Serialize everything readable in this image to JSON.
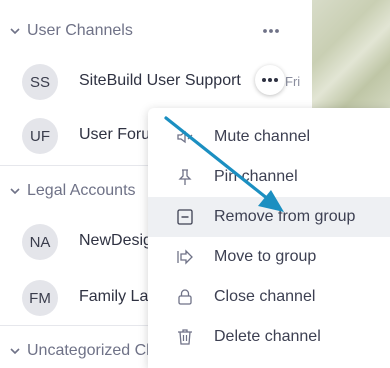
{
  "groups": [
    {
      "title": "User Channels"
    },
    {
      "title": "Legal Accounts"
    },
    {
      "title": "Uncategorized Channels"
    }
  ],
  "channels": [
    {
      "initials": "SS",
      "name": "SiteBuild User Support",
      "time": "Fri"
    },
    {
      "initials": "UF",
      "name": "User Forum"
    },
    {
      "initials": "NA",
      "name": "NewDesign Agency"
    },
    {
      "initials": "FM",
      "name": "Family Law Matters"
    }
  ],
  "menu": {
    "items": [
      {
        "label": "Mute channel",
        "icon": "speaker-muted-icon"
      },
      {
        "label": "Pin channel",
        "icon": "pin-icon"
      },
      {
        "label": "Remove from group",
        "icon": "minus-square-icon",
        "highlighted": true
      },
      {
        "label": "Move to group",
        "icon": "move-arrow-icon"
      },
      {
        "label": "Close channel",
        "icon": "lock-icon"
      },
      {
        "label": "Delete channel",
        "icon": "trash-icon"
      }
    ]
  },
  "colors": {
    "accent_arrow": "#1b8fc1",
    "highlight": "#eef0f3",
    "group_title": "#6f7287"
  }
}
